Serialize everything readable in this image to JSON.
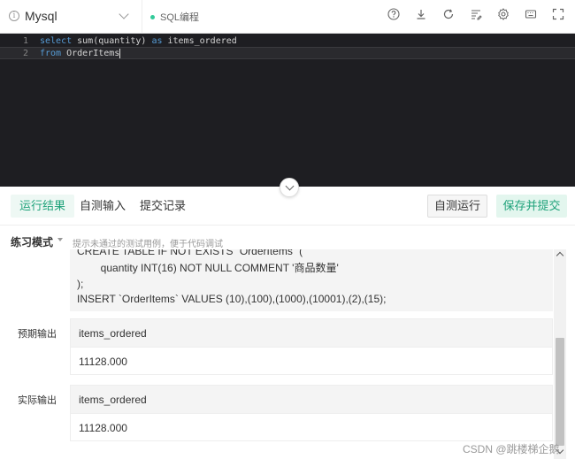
{
  "toolbar": {
    "db_name": "Mysql",
    "sql_tag": "SQL编程",
    "icons": [
      "help-icon",
      "download-icon",
      "refresh-icon",
      "format-icon",
      "settings-icon",
      "keyboard-icon",
      "fullscreen-icon"
    ]
  },
  "editor": {
    "lines": [
      {
        "num": "1",
        "kw1": "select",
        "mid": " sum(quantity) ",
        "kw2": "as",
        "rest": " items_ordered"
      },
      {
        "num": "2",
        "kw1": "from",
        "mid": " OrderItems",
        "kw2": "",
        "rest": ""
      }
    ]
  },
  "result_bar": {
    "tabs": [
      "运行结果",
      "自测输入",
      "提交记录"
    ],
    "test_run": "自测运行",
    "submit": "保存并提交"
  },
  "practice": {
    "mode": "练习模式",
    "hint": "提示未通过的测试用例，便于代码调试"
  },
  "test_case": {
    "lines": [
      "CREATE TABLE IF NOT EXISTS `OrderItems` (",
      "        quantity INT(16) NOT NULL COMMENT '商品数量'",
      ");",
      "INSERT `OrderItems` VALUES (10),(100),(1000),(10001),(2),(15);"
    ]
  },
  "expected": {
    "label": "预期输出",
    "column": "items_ordered",
    "value": "11128.000"
  },
  "actual": {
    "label": "实际输出",
    "column": "items_ordered",
    "value": "11128.000"
  },
  "watermark": "CSDN @跳楼梯企鹅"
}
